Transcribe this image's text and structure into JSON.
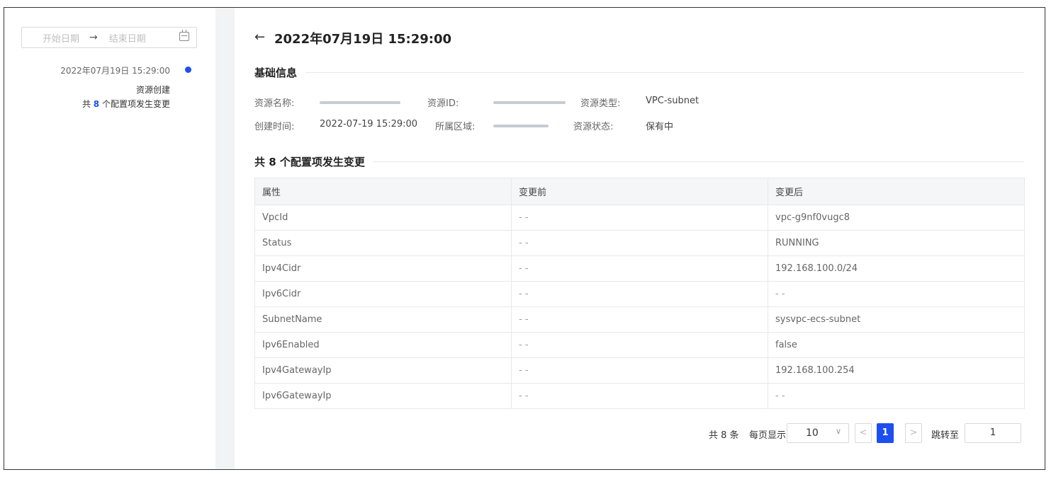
{
  "sidebar": {
    "date_start_placeholder": "开始日期",
    "date_arrow": "→",
    "date_end_placeholder": "结束日期",
    "timeline": {
      "time": "2022年07月19日 15:29:00",
      "action": "资源创建",
      "count_prefix": "共",
      "count": "8",
      "count_suffix": "个配置项发生变更"
    }
  },
  "main": {
    "back_arrow": "←",
    "title": "2022年07月19日 15:29:00",
    "basic_section_title": "基础信息",
    "basic_info": {
      "name_label": "资源名称:",
      "id_label": "资源ID:",
      "type_label": "资源类型:",
      "type_value": "VPC-subnet",
      "created_label": "创建时间:",
      "created_value": "2022-07-19 15:29:00",
      "region_label": "所属区域:",
      "status_label": "资源状态:",
      "status_value": "保有中"
    },
    "changes_section_title": "共 8 个配置项发生变更",
    "table": {
      "headers": [
        "属性",
        "变更前",
        "变更后"
      ],
      "rows": [
        {
          "attr": "VpcId",
          "before": "- -",
          "after": "vpc-g9nf0vugc8"
        },
        {
          "attr": "Status",
          "before": "- -",
          "after": "RUNNING"
        },
        {
          "attr": "Ipv4Cidr",
          "before": "- -",
          "after": "192.168.100.0/24"
        },
        {
          "attr": "Ipv6Cidr",
          "before": "- -",
          "after": "- -"
        },
        {
          "attr": "SubnetName",
          "before": "- -",
          "after": "sysvpc-ecs-subnet"
        },
        {
          "attr": "Ipv6Enabled",
          "before": "- -",
          "after": "false"
        },
        {
          "attr": "Ipv4GatewayIp",
          "before": "- -",
          "after": "192.168.100.254"
        },
        {
          "attr": "Ipv6GatewayIp",
          "before": "- -",
          "after": "- -"
        }
      ]
    },
    "pagination": {
      "total": "共 8 条",
      "page_size_label": "每页显示",
      "page_size": "10",
      "prev": "<",
      "current_page": "1",
      "next": ">",
      "jump_label": "跳转至",
      "jump_value": "1"
    }
  },
  "colors": {
    "accent": "#1d4ff0",
    "strip": "#f2f3f5",
    "table_header": "#f5f6f8"
  }
}
